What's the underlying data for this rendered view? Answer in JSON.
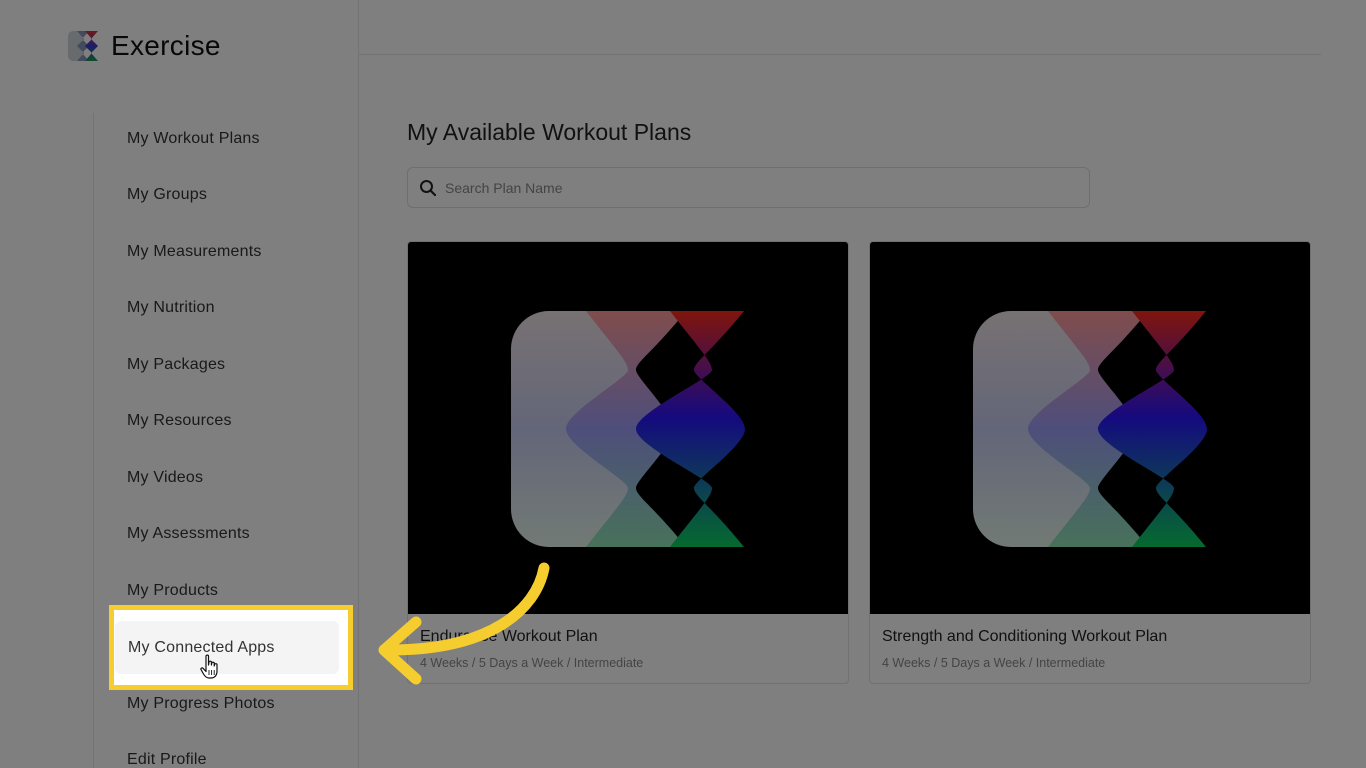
{
  "brand": {
    "name": "Exercise",
    "logo_icon": "exercise-logo-icon"
  },
  "sidebar": {
    "items": [
      {
        "label": "My Workout Plans"
      },
      {
        "label": "My Groups"
      },
      {
        "label": "My Measurements"
      },
      {
        "label": "My Nutrition"
      },
      {
        "label": "My Packages"
      },
      {
        "label": "My Resources"
      },
      {
        "label": "My Videos"
      },
      {
        "label": "My Assessments"
      },
      {
        "label": "My Products"
      },
      {
        "label": "My Connected Apps",
        "active": true
      },
      {
        "label": "My Progress Photos"
      },
      {
        "label": "Edit Profile"
      }
    ]
  },
  "main": {
    "title": "My Available Workout Plans",
    "search": {
      "placeholder": "Search Plan Name",
      "value": ""
    },
    "plans": [
      {
        "title": "Endurance Workout Plan",
        "meta": "4 Weeks / 5 Days a Week / Intermediate"
      },
      {
        "title": "Strength and Conditioning Workout Plan",
        "meta": "4 Weeks / 5 Days a Week / Intermediate"
      }
    ]
  },
  "annotation": {
    "highlight_color": "#f6cd2f",
    "arrow_color": "#f6cd2f",
    "cursor_icon": "hand-pointer-icon"
  }
}
